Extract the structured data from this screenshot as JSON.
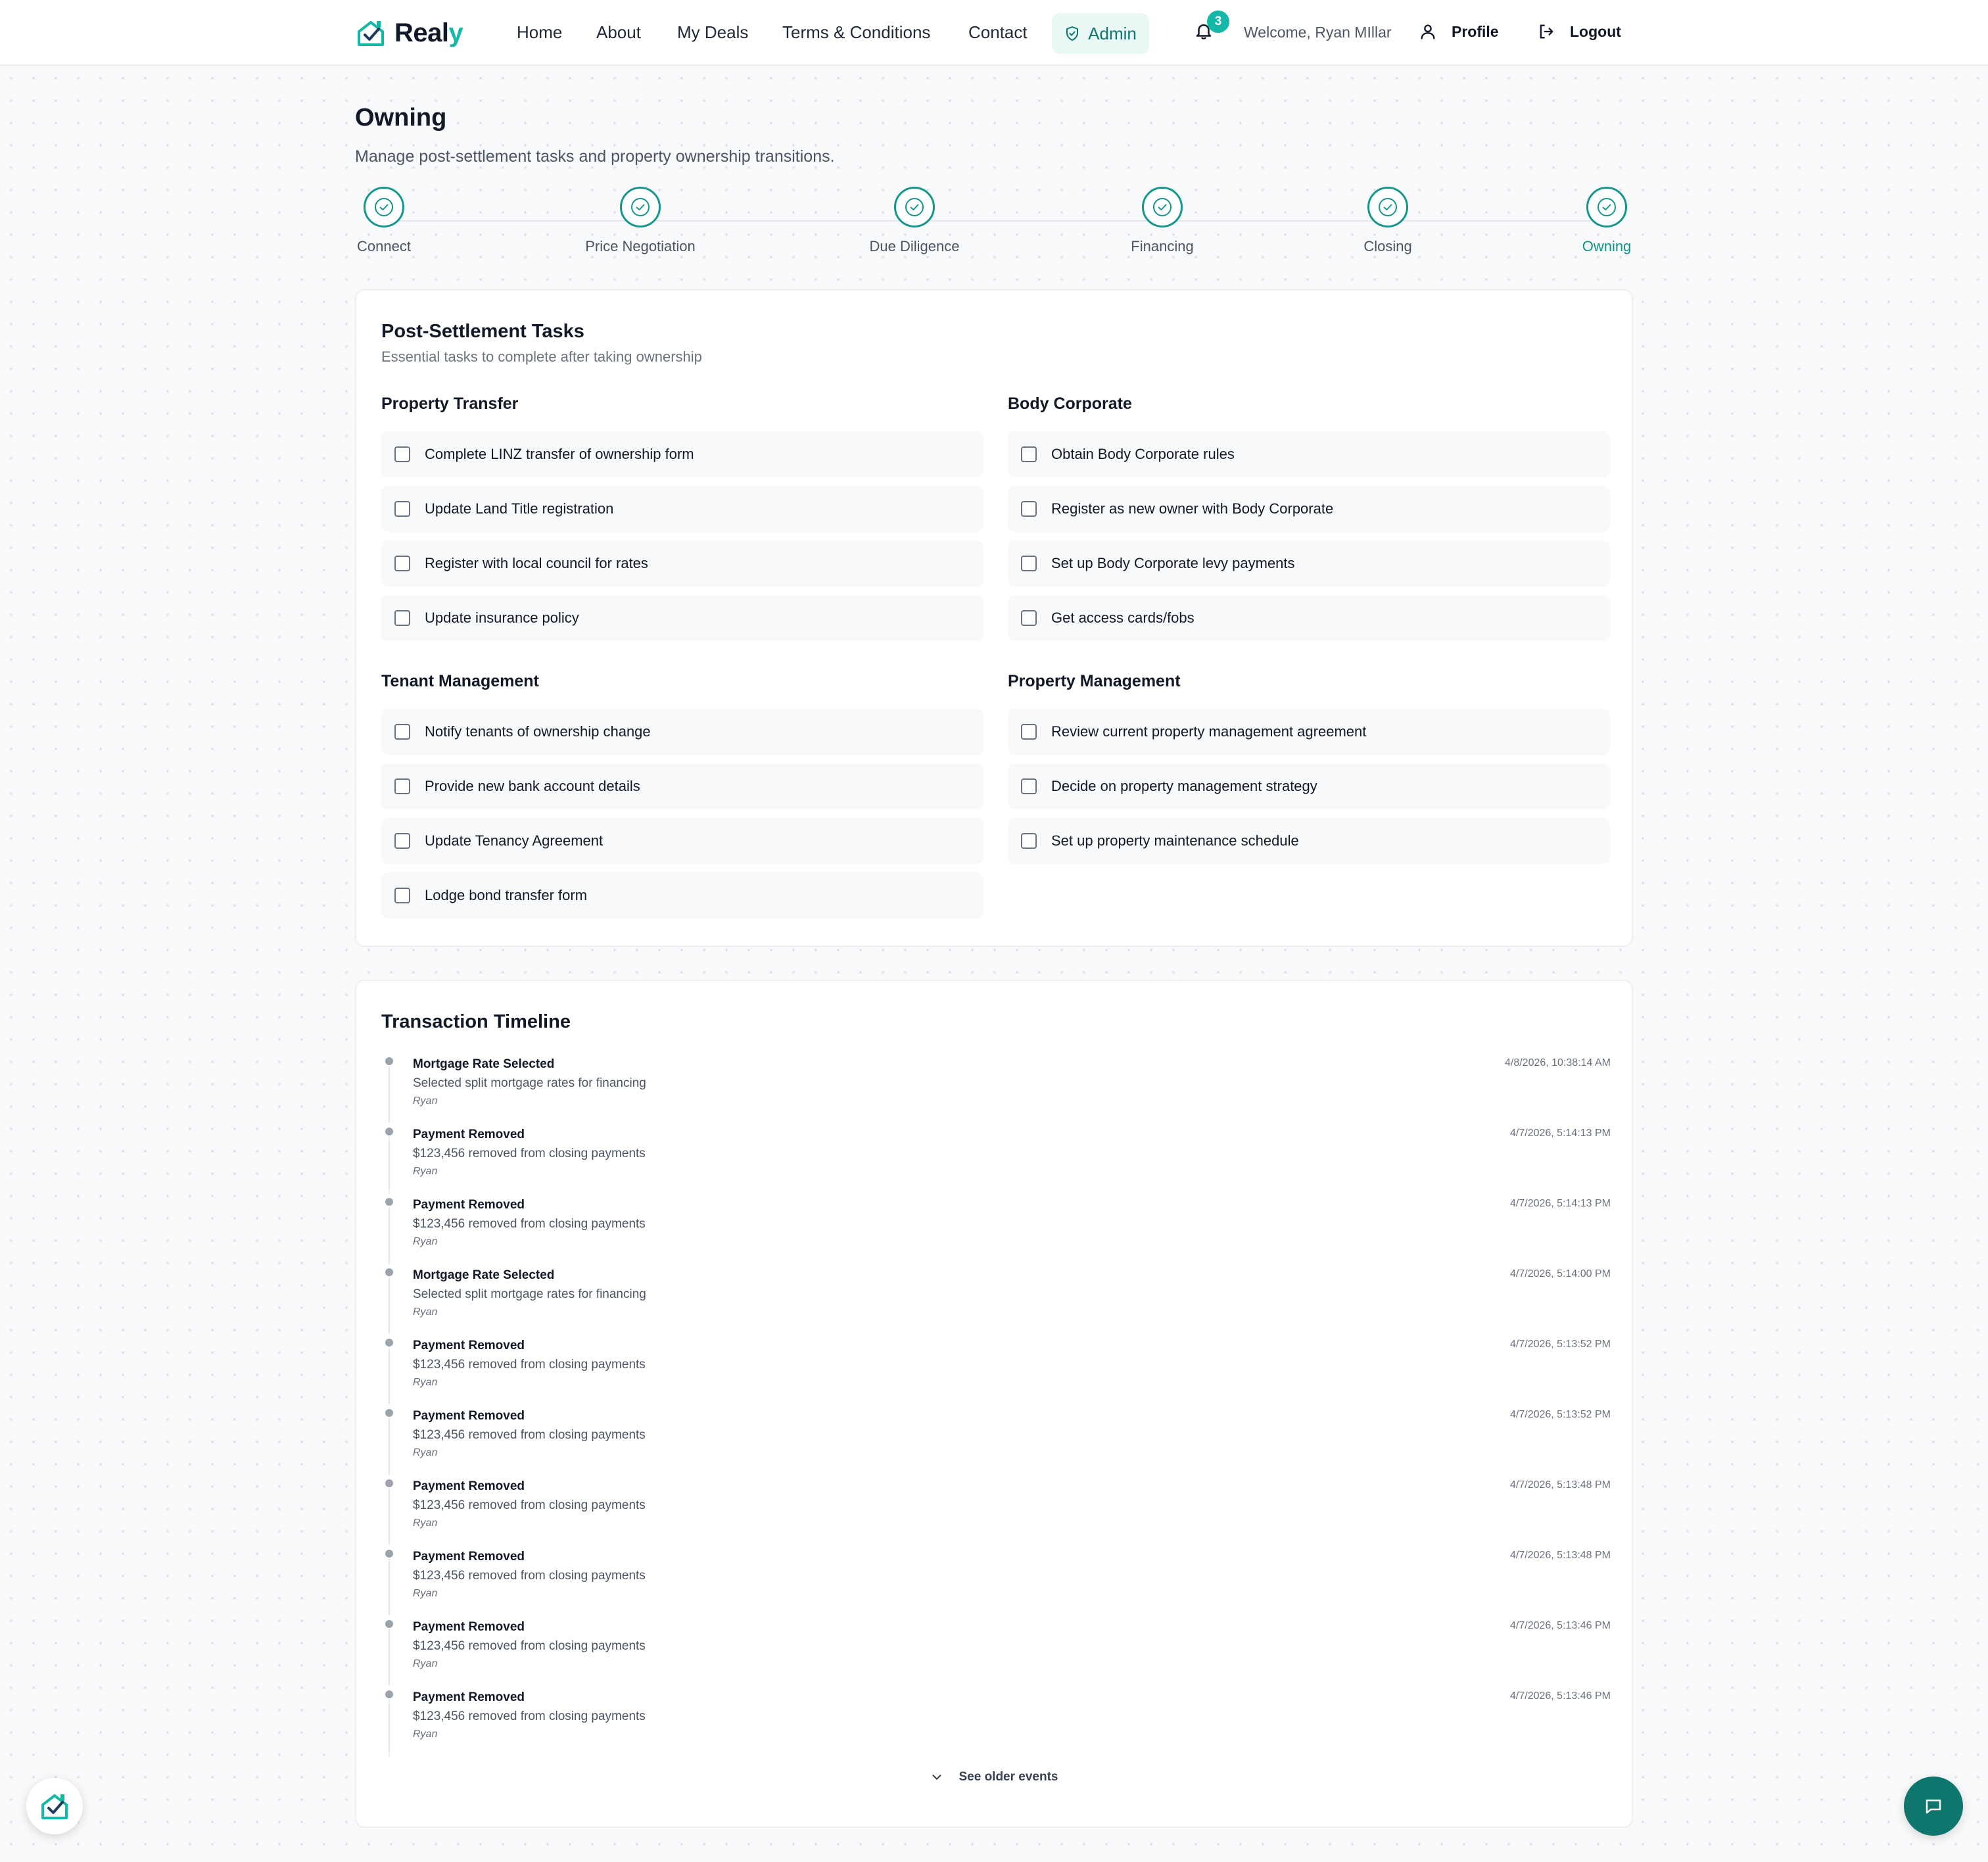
{
  "brand": {
    "name_main": "Real",
    "name_accent": "y",
    "accent_color": "#14b8a6",
    "primary_color": "#0f766e"
  },
  "nav": {
    "links": [
      "Home",
      "About",
      "My Deals",
      "Terms & Conditions",
      "Contact"
    ],
    "admin": "Admin",
    "notifications_count": "3",
    "welcome": "Welcome, Ryan MIllar",
    "profile": "Profile",
    "logout": "Logout"
  },
  "header": {
    "title": "Owning",
    "subtitle": "Manage post-settlement tasks and property ownership transitions."
  },
  "stepper": {
    "steps": [
      "Connect",
      "Price Negotiation",
      "Due Diligence",
      "Financing",
      "Closing",
      "Owning"
    ],
    "active": "Owning"
  },
  "tasks": {
    "title": "Post-Settlement Tasks",
    "subtitle": "Essential tasks to complete after taking ownership",
    "groups": [
      {
        "title": "Property Transfer",
        "items": [
          "Complete LINZ transfer of ownership form",
          "Update Land Title registration",
          "Register with local council for rates",
          "Update insurance policy"
        ]
      },
      {
        "title": "Body Corporate",
        "items": [
          "Obtain Body Corporate rules",
          "Register as new owner with Body Corporate",
          "Set up Body Corporate levy payments",
          "Get access cards/fobs"
        ]
      },
      {
        "title": "Tenant Management",
        "items": [
          "Notify tenants of ownership change",
          "Provide new bank account details",
          "Update Tenancy Agreement",
          "Lodge bond transfer form"
        ]
      },
      {
        "title": "Property Management",
        "items": [
          "Review current property management agreement",
          "Decide on property management strategy",
          "Set up property maintenance schedule"
        ]
      }
    ]
  },
  "timeline": {
    "title": "Transaction Timeline",
    "events": [
      {
        "title": "Mortgage Rate Selected",
        "desc": "Selected split mortgage rates for financing",
        "user": "Ryan",
        "time": "4/8/2026, 10:38:14 AM"
      },
      {
        "title": "Payment Removed",
        "desc": "$123,456 removed from closing payments",
        "user": "Ryan",
        "time": "4/7/2026, 5:14:13 PM"
      },
      {
        "title": "Payment Removed",
        "desc": "$123,456 removed from closing payments",
        "user": "Ryan",
        "time": "4/7/2026, 5:14:13 PM"
      },
      {
        "title": "Mortgage Rate Selected",
        "desc": "Selected split mortgage rates for financing",
        "user": "Ryan",
        "time": "4/7/2026, 5:14:00 PM"
      },
      {
        "title": "Payment Removed",
        "desc": "$123,456 removed from closing payments",
        "user": "Ryan",
        "time": "4/7/2026, 5:13:52 PM"
      },
      {
        "title": "Payment Removed",
        "desc": "$123,456 removed from closing payments",
        "user": "Ryan",
        "time": "4/7/2026, 5:13:52 PM"
      },
      {
        "title": "Payment Removed",
        "desc": "$123,456 removed from closing payments",
        "user": "Ryan",
        "time": "4/7/2026, 5:13:48 PM"
      },
      {
        "title": "Payment Removed",
        "desc": "$123,456 removed from closing payments",
        "user": "Ryan",
        "time": "4/7/2026, 5:13:48 PM"
      },
      {
        "title": "Payment Removed",
        "desc": "$123,456 removed from closing payments",
        "user": "Ryan",
        "time": "4/7/2026, 5:13:46 PM"
      },
      {
        "title": "Payment Removed",
        "desc": "$123,456 removed from closing payments",
        "user": "Ryan",
        "time": "4/7/2026, 5:13:46 PM"
      }
    ],
    "older_label": "See older events"
  },
  "icons": {
    "logo": "house-check-icon",
    "admin": "shield-icon",
    "bell": "bell-icon",
    "profile": "user-icon",
    "logout": "logout-icon",
    "step": "check-circle-icon",
    "older": "chevron-down-icon",
    "chat": "chat-icon"
  }
}
